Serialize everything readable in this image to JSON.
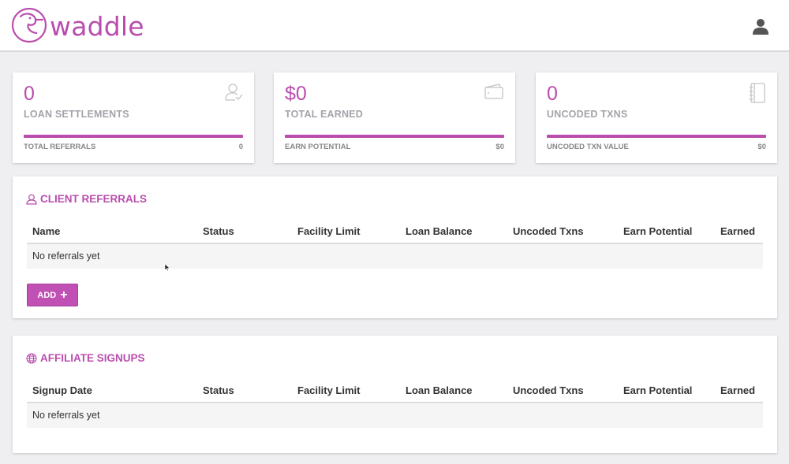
{
  "brand": {
    "name": "waddle",
    "color": "#b94dae"
  },
  "header": {
    "user_icon": "user-icon"
  },
  "stats": [
    {
      "value": "0",
      "label": "LOAN SETTLEMENTS",
      "sub_label": "TOTAL REFERRALS",
      "sub_value": "0",
      "icon": "user-check-icon"
    },
    {
      "value": "$0",
      "label": "TOTAL EARNED",
      "sub_label": "EARN POTENTIAL",
      "sub_value": "$0",
      "icon": "wallet-icon"
    },
    {
      "value": "0",
      "label": "UNCODED TXNS",
      "sub_label": "UNCODED TXN VALUE",
      "sub_value": "$0",
      "icon": "notebook-icon"
    }
  ],
  "client_referrals": {
    "title": "CLIENT REFERRALS",
    "icon": "user-icon",
    "columns": [
      "Name",
      "Status",
      "Facility Limit",
      "Loan Balance",
      "Uncoded Txns",
      "Earn Potential",
      "Earned"
    ],
    "empty_text": "No referrals yet",
    "add_label": "ADD",
    "add_icon": "plus-icon"
  },
  "affiliate_signups": {
    "title": "AFFILIATE SIGNUPS",
    "icon": "globe-icon",
    "columns": [
      "Signup Date",
      "Status",
      "Facility Limit",
      "Loan Balance",
      "Uncoded Txns",
      "Earn Potential",
      "Earned"
    ],
    "empty_text": "No referrals yet"
  }
}
